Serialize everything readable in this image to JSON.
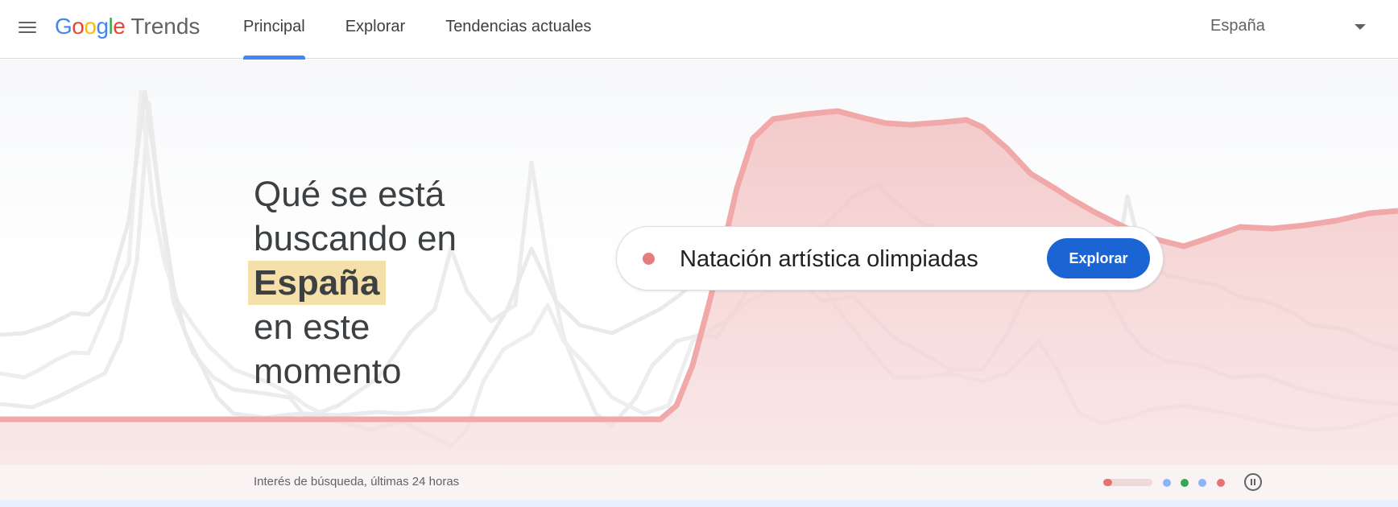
{
  "header": {
    "logo": {
      "letters": [
        {
          "char": "G",
          "color": "#4285f4"
        },
        {
          "char": "o",
          "color": "#ea4335"
        },
        {
          "char": "o",
          "color": "#fbbc05"
        },
        {
          "char": "g",
          "color": "#4285f4"
        },
        {
          "char": "l",
          "color": "#34a853"
        },
        {
          "char": "e",
          "color": "#ea4335"
        }
      ],
      "product": "Trends"
    },
    "menu_icon": "hamburger-menu-icon",
    "tabs": [
      {
        "label": "Principal",
        "active": true
      },
      {
        "label": "Explorar",
        "active": false
      },
      {
        "label": "Tendencias actuales",
        "active": false
      }
    ],
    "country": {
      "value": "España",
      "icon": "dropdown-caret-icon"
    }
  },
  "hero": {
    "headline": {
      "line1": "Qué se está",
      "line2": "buscando en",
      "country": "España",
      "line4": "en este",
      "line5": "momento"
    },
    "search": {
      "term": "Natación artística olimpiadas",
      "button_label": "Explorar",
      "dot_color": "#e57373"
    },
    "caption": "Interés de búsqueda, últimas 24 horas",
    "carousel": {
      "active_index": 0,
      "dots": [
        {
          "color": "#e57373"
        },
        {
          "color": "#8ab4f8"
        },
        {
          "color": "#34a853"
        },
        {
          "color": "#8ab4f8"
        },
        {
          "color": "#e57373"
        }
      ],
      "pause_icon": "pause-circle-icon"
    }
  },
  "colors": {
    "accent_blue": "#4285f4",
    "button_blue": "#1a65d3",
    "trend_red": "#f0a6a6",
    "highlight": "#f6e0a9"
  }
}
